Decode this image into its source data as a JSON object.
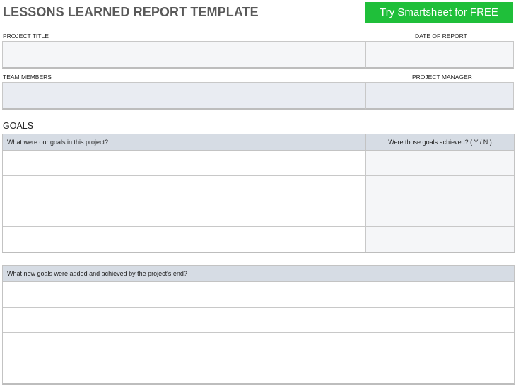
{
  "header": {
    "title": "LESSONS LEARNED REPORT TEMPLATE",
    "cta_label": "Try Smartsheet for FREE",
    "cta_color": "#1fbf3a"
  },
  "fields": {
    "project_title_label": "PROJECT TITLE",
    "project_title_value": "",
    "date_label": "DATE OF REPORT",
    "date_value": "",
    "team_members_label": "TEAM MEMBERS",
    "team_members_value": "",
    "project_manager_label": "PROJECT MANAGER",
    "project_manager_value": ""
  },
  "goals": {
    "section_title": "GOALS",
    "table1": {
      "col1_header": "What were our goals in this project?",
      "col2_header": "Were those goals achieved?  ( Y / N )",
      "rows": [
        [
          "",
          ""
        ],
        [
          "",
          ""
        ],
        [
          "",
          ""
        ],
        [
          "",
          ""
        ]
      ]
    },
    "table2": {
      "header": "What new goals were added and achieved by the project's end?",
      "rows": [
        "",
        "",
        "",
        ""
      ]
    }
  }
}
